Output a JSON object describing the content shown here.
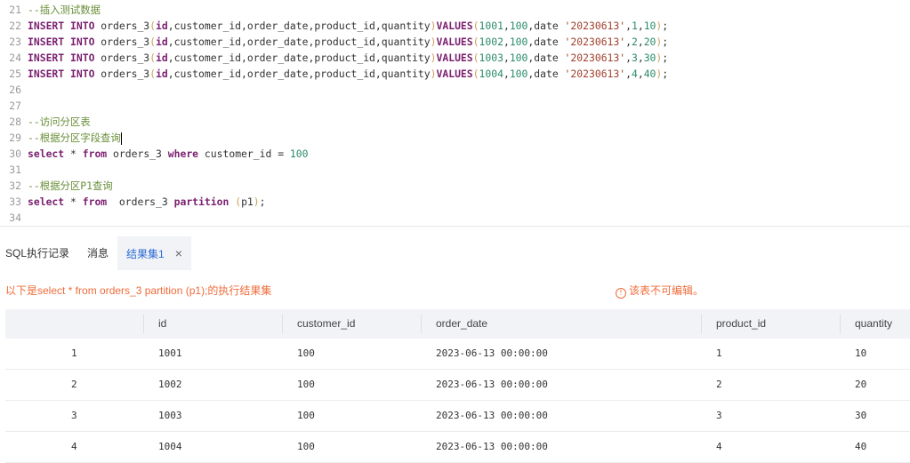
{
  "editor": {
    "lines": [
      {
        "n": "21",
        "segs": [
          {
            "c": "cm",
            "t": "--插入测试数据"
          }
        ]
      },
      {
        "n": "22",
        "segs": [
          {
            "c": "kw",
            "t": "INSERT INTO"
          },
          {
            "c": "",
            "t": " orders_3"
          },
          {
            "c": "par",
            "t": "("
          },
          {
            "c": "kw",
            "t": "id"
          },
          {
            "c": "",
            "t": ",customer_id,order_date,product_id,quantity"
          },
          {
            "c": "par",
            "t": ")"
          },
          {
            "c": "kw",
            "t": "VALUES"
          },
          {
            "c": "par",
            "t": "("
          },
          {
            "c": "num",
            "t": "1001"
          },
          {
            "c": "",
            "t": ","
          },
          {
            "c": "num",
            "t": "100"
          },
          {
            "c": "",
            "t": ",date "
          },
          {
            "c": "str",
            "t": "'20230613'"
          },
          {
            "c": "",
            "t": ","
          },
          {
            "c": "num",
            "t": "1"
          },
          {
            "c": "",
            "t": ","
          },
          {
            "c": "num",
            "t": "10"
          },
          {
            "c": "par",
            "t": ")"
          },
          {
            "c": "",
            "t": ";"
          }
        ]
      },
      {
        "n": "23",
        "segs": [
          {
            "c": "kw",
            "t": "INSERT INTO"
          },
          {
            "c": "",
            "t": " orders_3"
          },
          {
            "c": "par",
            "t": "("
          },
          {
            "c": "kw",
            "t": "id"
          },
          {
            "c": "",
            "t": ",customer_id,order_date,product_id,quantity"
          },
          {
            "c": "par",
            "t": ")"
          },
          {
            "c": "kw",
            "t": "VALUES"
          },
          {
            "c": "par",
            "t": "("
          },
          {
            "c": "num",
            "t": "1002"
          },
          {
            "c": "",
            "t": ","
          },
          {
            "c": "num",
            "t": "100"
          },
          {
            "c": "",
            "t": ",date "
          },
          {
            "c": "str",
            "t": "'20230613'"
          },
          {
            "c": "",
            "t": ","
          },
          {
            "c": "num",
            "t": "2"
          },
          {
            "c": "",
            "t": ","
          },
          {
            "c": "num",
            "t": "20"
          },
          {
            "c": "par",
            "t": ")"
          },
          {
            "c": "",
            "t": ";"
          }
        ]
      },
      {
        "n": "24",
        "segs": [
          {
            "c": "kw",
            "t": "INSERT INTO"
          },
          {
            "c": "",
            "t": " orders_3"
          },
          {
            "c": "par",
            "t": "("
          },
          {
            "c": "kw",
            "t": "id"
          },
          {
            "c": "",
            "t": ",customer_id,order_date,product_id,quantity"
          },
          {
            "c": "par",
            "t": ")"
          },
          {
            "c": "kw",
            "t": "VALUES"
          },
          {
            "c": "par",
            "t": "("
          },
          {
            "c": "num",
            "t": "1003"
          },
          {
            "c": "",
            "t": ","
          },
          {
            "c": "num",
            "t": "100"
          },
          {
            "c": "",
            "t": ",date "
          },
          {
            "c": "str",
            "t": "'20230613'"
          },
          {
            "c": "",
            "t": ","
          },
          {
            "c": "num",
            "t": "3"
          },
          {
            "c": "",
            "t": ","
          },
          {
            "c": "num",
            "t": "30"
          },
          {
            "c": "par",
            "t": ")"
          },
          {
            "c": "",
            "t": ";"
          }
        ]
      },
      {
        "n": "25",
        "segs": [
          {
            "c": "kw",
            "t": "INSERT INTO"
          },
          {
            "c": "",
            "t": " orders_3"
          },
          {
            "c": "par",
            "t": "("
          },
          {
            "c": "kw",
            "t": "id"
          },
          {
            "c": "",
            "t": ",customer_id,order_date,product_id,quantity"
          },
          {
            "c": "par",
            "t": ")"
          },
          {
            "c": "kw",
            "t": "VALUES"
          },
          {
            "c": "par",
            "t": "("
          },
          {
            "c": "num",
            "t": "1004"
          },
          {
            "c": "",
            "t": ","
          },
          {
            "c": "num",
            "t": "100"
          },
          {
            "c": "",
            "t": ",date "
          },
          {
            "c": "str",
            "t": "'20230613'"
          },
          {
            "c": "",
            "t": ","
          },
          {
            "c": "num",
            "t": "4"
          },
          {
            "c": "",
            "t": ","
          },
          {
            "c": "num",
            "t": "40"
          },
          {
            "c": "par",
            "t": ")"
          },
          {
            "c": "",
            "t": ";"
          }
        ]
      },
      {
        "n": "26",
        "segs": []
      },
      {
        "n": "27",
        "segs": []
      },
      {
        "n": "28",
        "segs": [
          {
            "c": "cm",
            "t": "--访问分区表"
          }
        ]
      },
      {
        "n": "29",
        "segs": [
          {
            "c": "cm",
            "t": "--根据分区字段查询"
          }
        ],
        "cursor": true
      },
      {
        "n": "30",
        "segs": [
          {
            "c": "kw",
            "t": "select"
          },
          {
            "c": "",
            "t": " * "
          },
          {
            "c": "kw",
            "t": "from"
          },
          {
            "c": "",
            "t": " orders_3 "
          },
          {
            "c": "kw",
            "t": "where"
          },
          {
            "c": "",
            "t": " customer_id = "
          },
          {
            "c": "num",
            "t": "100"
          }
        ]
      },
      {
        "n": "31",
        "segs": []
      },
      {
        "n": "32",
        "segs": [
          {
            "c": "cm",
            "t": "--根据分区P1查询"
          }
        ]
      },
      {
        "n": "33",
        "segs": [
          {
            "c": "kw",
            "t": "select"
          },
          {
            "c": "",
            "t": " * "
          },
          {
            "c": "kw",
            "t": "from"
          },
          {
            "c": "",
            "t": "  orders_3 "
          },
          {
            "c": "kw",
            "t": "partition"
          },
          {
            "c": "",
            "t": " "
          },
          {
            "c": "par",
            "t": "("
          },
          {
            "c": "",
            "t": "p1"
          },
          {
            "c": "par",
            "t": ")"
          },
          {
            "c": "",
            "t": ";"
          }
        ]
      },
      {
        "n": "34",
        "segs": []
      }
    ]
  },
  "tabs": {
    "sql_log": "SQL执行记录",
    "messages": "消息",
    "result_set": "结果集1",
    "close": "×"
  },
  "result": {
    "message": "以下是select * from orders_3 partition (p1);的执行结果集",
    "readonly_note": "该表不可编辑。",
    "warn_icon": "!",
    "columns": [
      "",
      "id",
      "customer_id",
      "order_date",
      "product_id",
      "quantity"
    ],
    "rows": [
      [
        "1",
        "1001",
        "100",
        "2023-06-13 00:00:00",
        "1",
        "10"
      ],
      [
        "2",
        "1002",
        "100",
        "2023-06-13 00:00:00",
        "2",
        "20"
      ],
      [
        "3",
        "1003",
        "100",
        "2023-06-13 00:00:00",
        "3",
        "30"
      ],
      [
        "4",
        "1004",
        "100",
        "2023-06-13 00:00:00",
        "4",
        "40"
      ]
    ]
  },
  "colors": {
    "accent": "#2d6bd6",
    "warning": "#f06b3a",
    "header_bg": "#f1f3f6"
  }
}
